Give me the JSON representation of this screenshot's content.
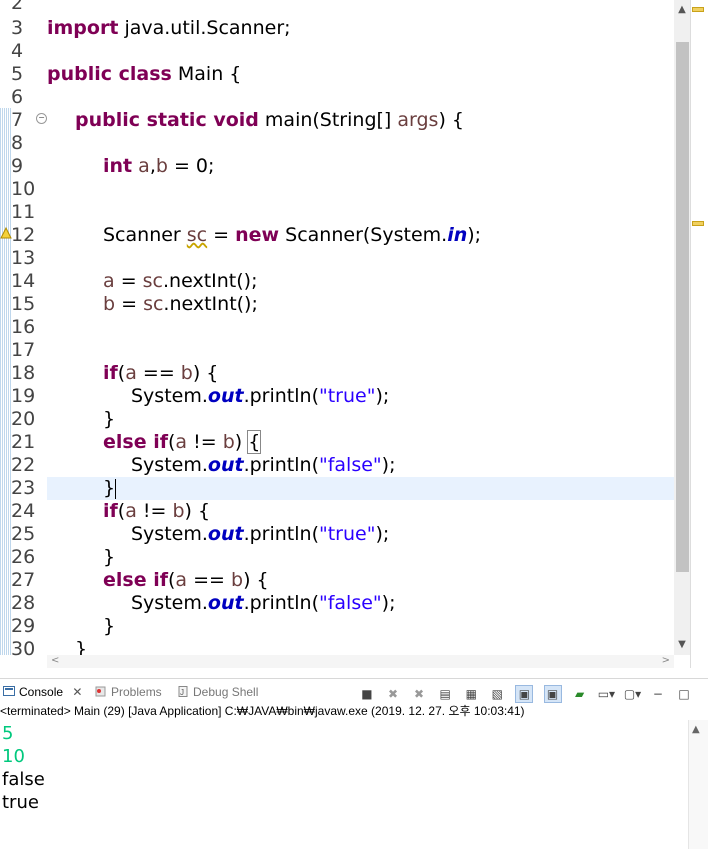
{
  "editor": {
    "line_numbers": [
      "2",
      "3",
      "4",
      "5",
      "6",
      "7",
      "8",
      "9",
      "10",
      "11",
      "12",
      "13",
      "14",
      "15",
      "16",
      "17",
      "18",
      "19",
      "20",
      "21",
      "22",
      "23",
      "24",
      "25",
      "26",
      "27",
      "28",
      "29",
      "30"
    ],
    "code": {
      "l3_kw": "import",
      "l3_rest": " java.util.Scanner;",
      "l5_kw": "public class",
      "l5_rest": " Main {",
      "l7_kw": "public static void",
      "l7_rest": " main(String[] ",
      "l7_var": "args",
      "l7_end": ") {",
      "l9_kw": "int",
      "l9_a": " a",
      "l9_comma": ",",
      "l9_b": "b",
      "l9_end": " = 0;",
      "l12_a": "Scanner ",
      "l12_sc": "sc",
      "l12_eq": " = ",
      "l12_new": "new",
      "l12_b": " Scanner(System.",
      "l12_in": "in",
      "l12_end": ");",
      "l14_a": "a",
      "l14_b": " = ",
      "l14_sc": "sc",
      "l14_end": ".nextInt();",
      "l15_a": "b",
      "l15_b": " = ",
      "l15_sc": "sc",
      "l15_end": ".nextInt();",
      "if_kw": "if",
      "else_if_kw": "else if",
      "cond_eq_a": "a",
      "cond_eq_op": " == ",
      "cond_eq_b": "b",
      "cond_ne_a": "a",
      "cond_ne_op": " != ",
      "cond_ne_b": "b",
      "sys": "System.",
      "out": "out",
      "println": ".println(",
      "str_true": "\"true\"",
      "str_false": "\"false\"",
      "close_call": ");",
      "open_paren": "(",
      "close_brace_open": ") {",
      "close_paren": ")",
      "space": " ",
      "open_brace": "{",
      "close_brace": "}"
    }
  },
  "console": {
    "tabs": [
      {
        "label": "Console",
        "close": "✕"
      },
      {
        "label": "Problems"
      },
      {
        "label": "Debug Shell"
      }
    ],
    "status": "<terminated> Main (29) [Java Application] C:₩JAVA₩bin₩javaw.exe (2019. 12. 27. 오후 10:03:41)",
    "output": [
      "5",
      "10",
      "false",
      "true"
    ]
  },
  "colors": {
    "keyword": "#7f0055",
    "string": "#2a00ff",
    "static_field": "#0000c0",
    "user_input": "#00c87d",
    "current_line": "#e8f2fe"
  }
}
